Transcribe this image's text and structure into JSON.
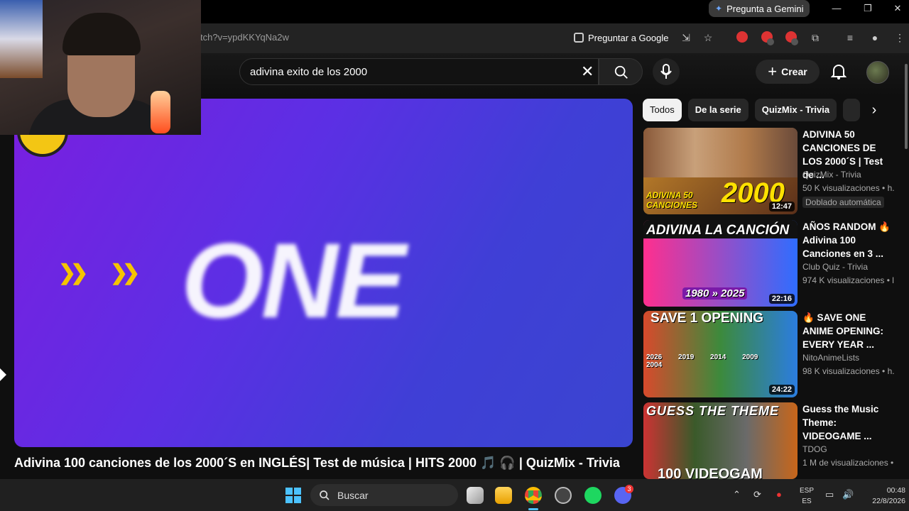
{
  "browser": {
    "gemini_button": "Pregunta a Gemini",
    "url_fragment": "tch?v=ypdKKYqNa2w",
    "google_button": "Preguntar a Google"
  },
  "youtube": {
    "search_query": "adivina exito de los 2000",
    "create_label": "Crear",
    "player_overlay_text": "ONE",
    "video_title": "Adivina 100 canciones de los 2000´S en INGLÉS| Test de música | HITS 2000 🎵 🎧  | QuizMix - Trivia",
    "chips": [
      "Todos",
      "De la serie",
      "QuizMix - Trivia"
    ],
    "recommendations": [
      {
        "thumb_text": "2000",
        "thumb_sub": "ADIVINA 50 CANCIONES",
        "duration": "12:47",
        "title": "ADIVINA 50 CANCIONES DE LOS 2000´S | Test de ...",
        "channel": "QuizMix - Trivia",
        "views": "50 K visualizaciones • h.",
        "extra": "Doblado automática",
        "color1": "#d9a21d",
        "color2": "#6b3a1e"
      },
      {
        "thumb_text": "ADIVINA LA CANCIÓN",
        "thumb_sub": "1980 » 2025",
        "duration": "22:16",
        "title": "AÑOS RANDOM 🔥 Adivina 100 Canciones en 3 ...",
        "channel": "Club Quiz - Trivia",
        "views": "974 K visualizaciones • l",
        "extra": "",
        "color1": "#ff2f8e",
        "color2": "#2f6dff"
      },
      {
        "thumb_text": "SAVE 1 OPENING",
        "thumb_sub": "2026 2019 2014 2009 2004",
        "duration": "24:22",
        "title": "🔥 SAVE ONE ANIME OPENING: EVERY YEAR ...",
        "channel": "NitoAnimeLists",
        "views": "98 K visualizaciones • h.",
        "extra": "",
        "color1": "#e94b2c",
        "color2": "#2b7de0"
      },
      {
        "thumb_text": "GUESS THE THEME",
        "thumb_sub": "100 VIDEOGAM",
        "duration": "",
        "title": "Guess the Music Theme: VIDEOGAME ...",
        "channel": "TDOG",
        "views": "1 M de visualizaciones •",
        "extra": "",
        "color1": "#4a6a2a",
        "color2": "#a84a1a"
      }
    ]
  },
  "taskbar": {
    "search_label": "Buscar",
    "lang_line1": "ESP",
    "lang_line2": "ES",
    "time": "00:48",
    "date": "22/8/2026",
    "discord_badge": "3"
  }
}
